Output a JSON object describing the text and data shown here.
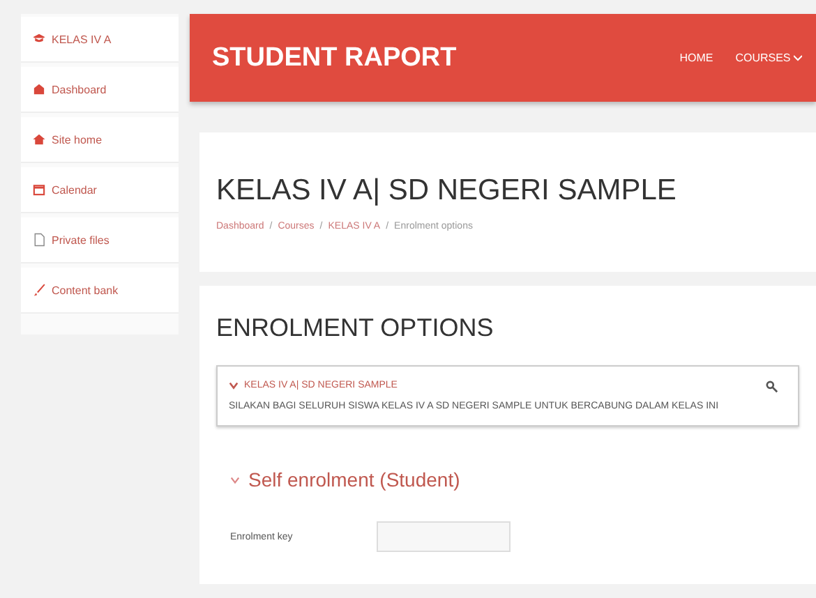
{
  "sidebar": {
    "items": [
      {
        "label": "KELAS IV A"
      },
      {
        "label": "Dashboard"
      },
      {
        "label": "Site home"
      },
      {
        "label": "Calendar"
      },
      {
        "label": "Private files"
      },
      {
        "label": "Content bank"
      }
    ]
  },
  "navbar": {
    "brand": "STUDENT RAPORT",
    "links": [
      {
        "label": "HOME",
        "dropdown": false
      },
      {
        "label": "COURSES",
        "dropdown": true
      }
    ]
  },
  "header": {
    "title": "KELAS IV A| SD NEGERI SAMPLE",
    "breadcrumb": [
      "Dashboard",
      "Courses",
      "KELAS IV A",
      "Enrolment options"
    ],
    "breadcrumb_separator": "/"
  },
  "enrolment": {
    "heading": "ENROLMENT OPTIONS",
    "course": {
      "name": "KELAS IV A| SD NEGERI SAMPLE",
      "expanded": true,
      "summary": "SILAKAN BAGI SELURUH SISWA KELAS IV A SD NEGERI SAMPLE UNTUK BERCABUNG DALAM KELAS INI"
    },
    "section": {
      "title": "Self enrolment (Student)",
      "expanded": true
    },
    "fields": [
      {
        "label": "Enrolment key"
      }
    ]
  }
}
